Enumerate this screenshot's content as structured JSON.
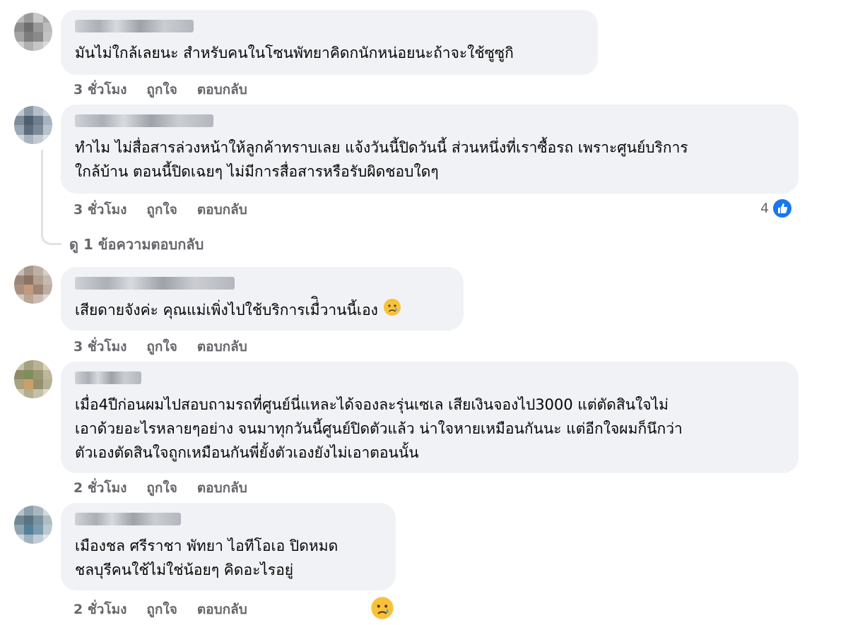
{
  "comments": [
    {
      "text_lines": [
        "มันไม่ใกล้เลยนะ สำหรับคนในโซนพัทยาคิดกนักหน่อยนะถ้าจะใช้ซูซูกิ"
      ],
      "time": "3 ชั่วโมง",
      "like_label": "ถูกใจ",
      "reply_label": "ตอบกลับ"
    },
    {
      "text_lines": [
        "ทำไม ไม่สื่อสารล่วงหน้าให้ลูกค้าทราบเลย แจ้งวันนี้ปิดวันนี้ ส่วนหนึ่งที่เราซื้อรถ เพราะศูนย์บริการ",
        "ใกล้บ้าน ตอนนี้ปิดเฉยๆ ไม่มีการสื่อสารหรือรับผิดชอบใดๆ"
      ],
      "time": "3 ชั่วโมง",
      "like_label": "ถูกใจ",
      "reply_label": "ตอบกลับ",
      "reaction_count": "4",
      "view_replies": "ดู 1 ข้อความตอบกลับ"
    },
    {
      "text_lines": [
        "เสียดายจังค่ะ คุณแม่เพิ่งไปใช้บริการเมื่ิวานนี้เอง"
      ],
      "time": "3 ชั่วโมง",
      "like_label": "ถูกใจ",
      "reply_label": "ตอบกลับ"
    },
    {
      "text_lines": [
        "เมื่อ4ปีก่อนผมไปสอบถามรถที่ศูนย์นี่แหละได้จองละรุ่นเซเล เสียเงินจองไป3000 แต่ตัดสินใจไม่",
        "เอาด้วยอะไรหลายๆอย่าง จนมาทุกวันนี้ศูนย์ปิดตัวแล้ว น่าใจหายเหมือนกันนะ แต่อีกใจผมก็นึกว่า",
        "ตัวเองตัดสินใจถูกเหมือนกันพี่ยั้งตัวเองยังไม่เอาตอนนั้น"
      ],
      "time": "2 ชั่วโมง",
      "like_label": "ถูกใจ",
      "reply_label": "ตอบกลับ"
    },
    {
      "text_lines": [
        "เมืองชล ศรีราชา พัทยา ไอทีโอเอ ปิดหมด",
        "ชลบุรีคนใช้ไม่ใช่น้อยๆ คิดอะไรอยู่"
      ],
      "time": "2 ชั่วโมง",
      "like_label": "ถูกใจ",
      "reply_label": "ตอบกลับ"
    }
  ],
  "colors": {
    "bubble": "#f0f2f5",
    "meta_text": "#65676b",
    "like_blue": "#1877f2"
  },
  "icons": [
    "crying-face-emoji",
    "like-thumb-icon"
  ]
}
